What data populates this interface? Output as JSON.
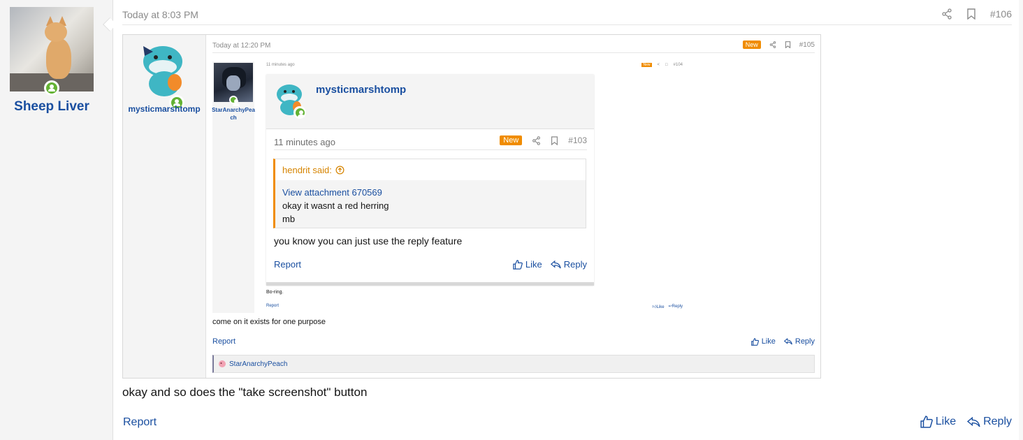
{
  "post": {
    "author": "Sheep Liver",
    "time": "Today at 8:03 PM",
    "number": "#106",
    "text": "okay and so does the \"take screenshot\" button",
    "report": "Report",
    "like": "Like",
    "reply": "Reply"
  },
  "embed1": {
    "author": "mysticmarshtomp",
    "time": "Today at 12:20 PM",
    "new_badge": "New",
    "number": "#105",
    "text": "come on it exists for one purpose",
    "report": "Report",
    "like": "Like",
    "reply": "Reply",
    "likes_by": "StarAnarchyPeach"
  },
  "embed2": {
    "author": "StarAnarchyPeach",
    "time": "11 minutes ago",
    "new_badge": "New",
    "number": "#104",
    "text": "Bo-ring.",
    "report": "Report",
    "like": "Like",
    "reply": "Reply"
  },
  "embed3": {
    "author": "mysticmarshtomp",
    "time": "11 minutes ago",
    "new_badge": "New",
    "number": "#103",
    "quote_author": "hendrit said:",
    "quote_link": "View attachment 670569",
    "quote_line1": "okay it wasnt a red herring",
    "quote_line2": "mb",
    "text": "you know you can just use the reply feature",
    "report": "Report",
    "like": "Like",
    "reply": "Reply"
  },
  "colors": {
    "link": "#1a4fa0",
    "accent_new": "#f08c00",
    "online": "#63b233"
  }
}
